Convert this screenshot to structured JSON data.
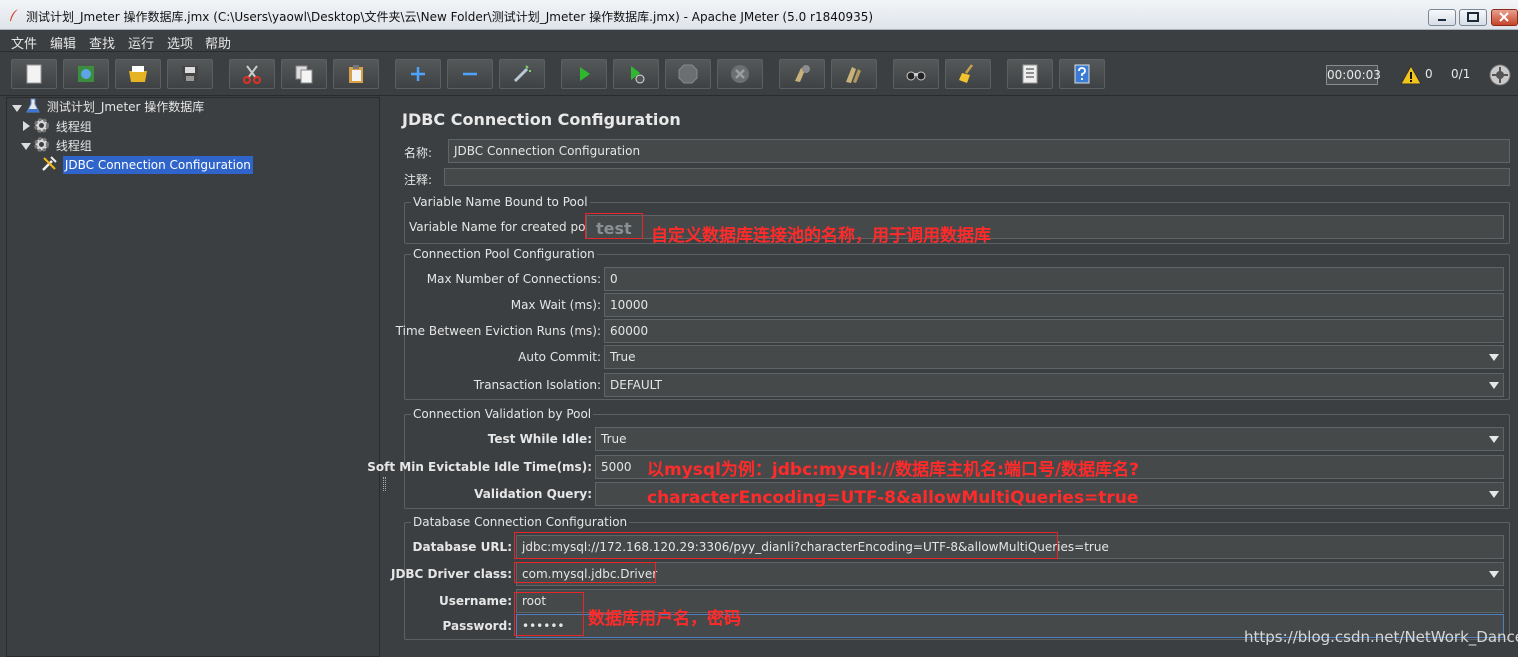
{
  "window": {
    "title": "测试计划_Jmeter 操作数据库.jmx (C:\\Users\\yaowl\\Desktop\\文件夹\\云\\New Folder\\测试计划_Jmeter 操作数据库.jmx) - Apache JMeter (5.0 r1840935)"
  },
  "menu": [
    "文件",
    "编辑",
    "查找",
    "运行",
    "选项",
    "帮助"
  ],
  "toolbar": {
    "icons": [
      "new-icon",
      "templates-icon",
      "open-icon",
      "save-icon",
      "cut-icon",
      "copy-icon",
      "paste-icon",
      "expand-icon",
      "collapse-icon",
      "toggle-icon",
      "start-icon",
      "start-no-timers-icon",
      "stop-icon",
      "shutdown-icon",
      "clear-icon",
      "clear-all-icon",
      "search-icon",
      "reset-search-icon",
      "function-helper-icon",
      "help-icon"
    ],
    "timer": "00:00:03",
    "warning_count": "0",
    "thread_ratio": "0/1"
  },
  "tree": {
    "root": "测试计划_Jmeter 操作数据库",
    "thread_group_1": "线程组",
    "thread_group_2": "线程组",
    "selected_node": "JDBC Connection Configuration"
  },
  "form": {
    "title": "JDBC Connection Configuration",
    "name_label": "名称:",
    "name_value": "JDBC Connection Configuration",
    "comment_label": "注释:",
    "comment_value": "",
    "var_group": "Variable Name Bound to Pool",
    "var_label": "Variable Name for created pool:",
    "var_value": "test",
    "pool_group": "Connection Pool Configuration",
    "max_conn_label": "Max Number of Connections:",
    "max_conn_value": "0",
    "max_wait_label": "Max Wait (ms):",
    "max_wait_value": "10000",
    "eviction_label": "Time Between Eviction Runs (ms):",
    "eviction_value": "60000",
    "auto_commit_label": "Auto Commit:",
    "auto_commit_value": "True",
    "tx_iso_label": "Transaction Isolation:",
    "tx_iso_value": "DEFAULT",
    "validation_group": "Connection Validation by Pool",
    "test_idle_label": "Test While Idle:",
    "test_idle_value": "True",
    "soft_min_label": "Soft Min Evictable Idle Time(ms):",
    "soft_min_value": "5000",
    "validation_query_label": "Validation Query:",
    "validation_query_value": "",
    "db_group": "Database Connection Configuration",
    "db_url_label": "Database URL:",
    "db_url_value": "jdbc:mysql://172.168.120.29:3306/pyy_dianli?characterEncoding=UTF-8&allowMultiQueries=true",
    "driver_label": "JDBC Driver class:",
    "driver_value": "com.mysql.jdbc.Driver",
    "username_label": "Username:",
    "username_value": "root",
    "password_label": "Password:",
    "password_value": "••••••"
  },
  "annotations": {
    "pool_name_note": "自定义数据库连接池的名称，用于调用数据库",
    "url_note_line1": "以mysql为例：jdbc:mysql://数据库主机名:端口号/数据库名?",
    "url_note_line2": "characterEncoding=UTF-8&allowMultiQueries=true",
    "user_note": "数据库用户名，密码"
  },
  "watermark": "https://blog.csdn.net/NetWork_Dance"
}
